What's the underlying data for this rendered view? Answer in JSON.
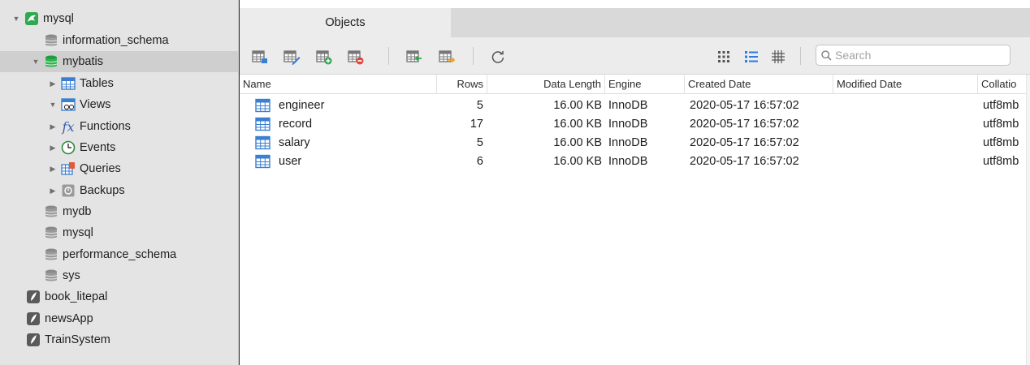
{
  "sidebar": {
    "connection": {
      "label": "mysql",
      "icon": "mysql-dolphin-icon"
    },
    "databases": [
      {
        "label": "information_schema"
      },
      {
        "label": "mybatis",
        "selected": true
      },
      {
        "label": "mydb"
      },
      {
        "label": "mysql"
      },
      {
        "label": "performance_schema"
      },
      {
        "label": "sys"
      }
    ],
    "mybatis_children": [
      {
        "label": "Tables",
        "icon": "table-icon"
      },
      {
        "label": "Views",
        "icon": "view-icon"
      },
      {
        "label": "Functions",
        "icon": "function-icon"
      },
      {
        "label": "Events",
        "icon": "clock-icon"
      },
      {
        "label": "Queries",
        "icon": "query-icon"
      },
      {
        "label": "Backups",
        "icon": "backup-icon"
      }
    ],
    "other_connections": [
      {
        "label": "book_litepal"
      },
      {
        "label": "newsApp"
      },
      {
        "label": "TrainSystem"
      }
    ]
  },
  "tabs": [
    {
      "label": "Objects",
      "active": true
    }
  ],
  "toolbar": {
    "search_placeholder": "Search",
    "buttons": [
      "open-table-icon",
      "design-table-icon",
      "new-table-icon",
      "delete-table-icon",
      "import-wizard-icon",
      "export-wizard-icon",
      "refresh-icon",
      "grid-view-icon",
      "list-view-icon",
      "detail-view-icon"
    ]
  },
  "table": {
    "columns": {
      "name": "Name",
      "rows": "Rows",
      "data_length": "Data Length",
      "engine": "Engine",
      "created": "Created Date",
      "modified": "Modified Date",
      "collation": "Collatio"
    },
    "rows": [
      {
        "name": "engineer",
        "rows": "5",
        "data_length": "16.00 KB",
        "engine": "InnoDB",
        "created": "2020-05-17 16:57:02",
        "modified": "",
        "collation": "utf8mb"
      },
      {
        "name": "record",
        "rows": "17",
        "data_length": "16.00 KB",
        "engine": "InnoDB",
        "created": "2020-05-17 16:57:02",
        "modified": "",
        "collation": "utf8mb"
      },
      {
        "name": "salary",
        "rows": "5",
        "data_length": "16.00 KB",
        "engine": "InnoDB",
        "created": "2020-05-17 16:57:02",
        "modified": "",
        "collation": "utf8mb"
      },
      {
        "name": "user",
        "rows": "6",
        "data_length": "16.00 KB",
        "engine": "InnoDB",
        "created": "2020-05-17 16:57:02",
        "modified": "",
        "collation": "utf8mb"
      }
    ]
  },
  "colors": {
    "sidebar_bg": "#e4e4e4",
    "selected_row": "#cfcfcf",
    "accent_green": "#2fa84f",
    "table_icon_blue": "#3a7fd1"
  }
}
